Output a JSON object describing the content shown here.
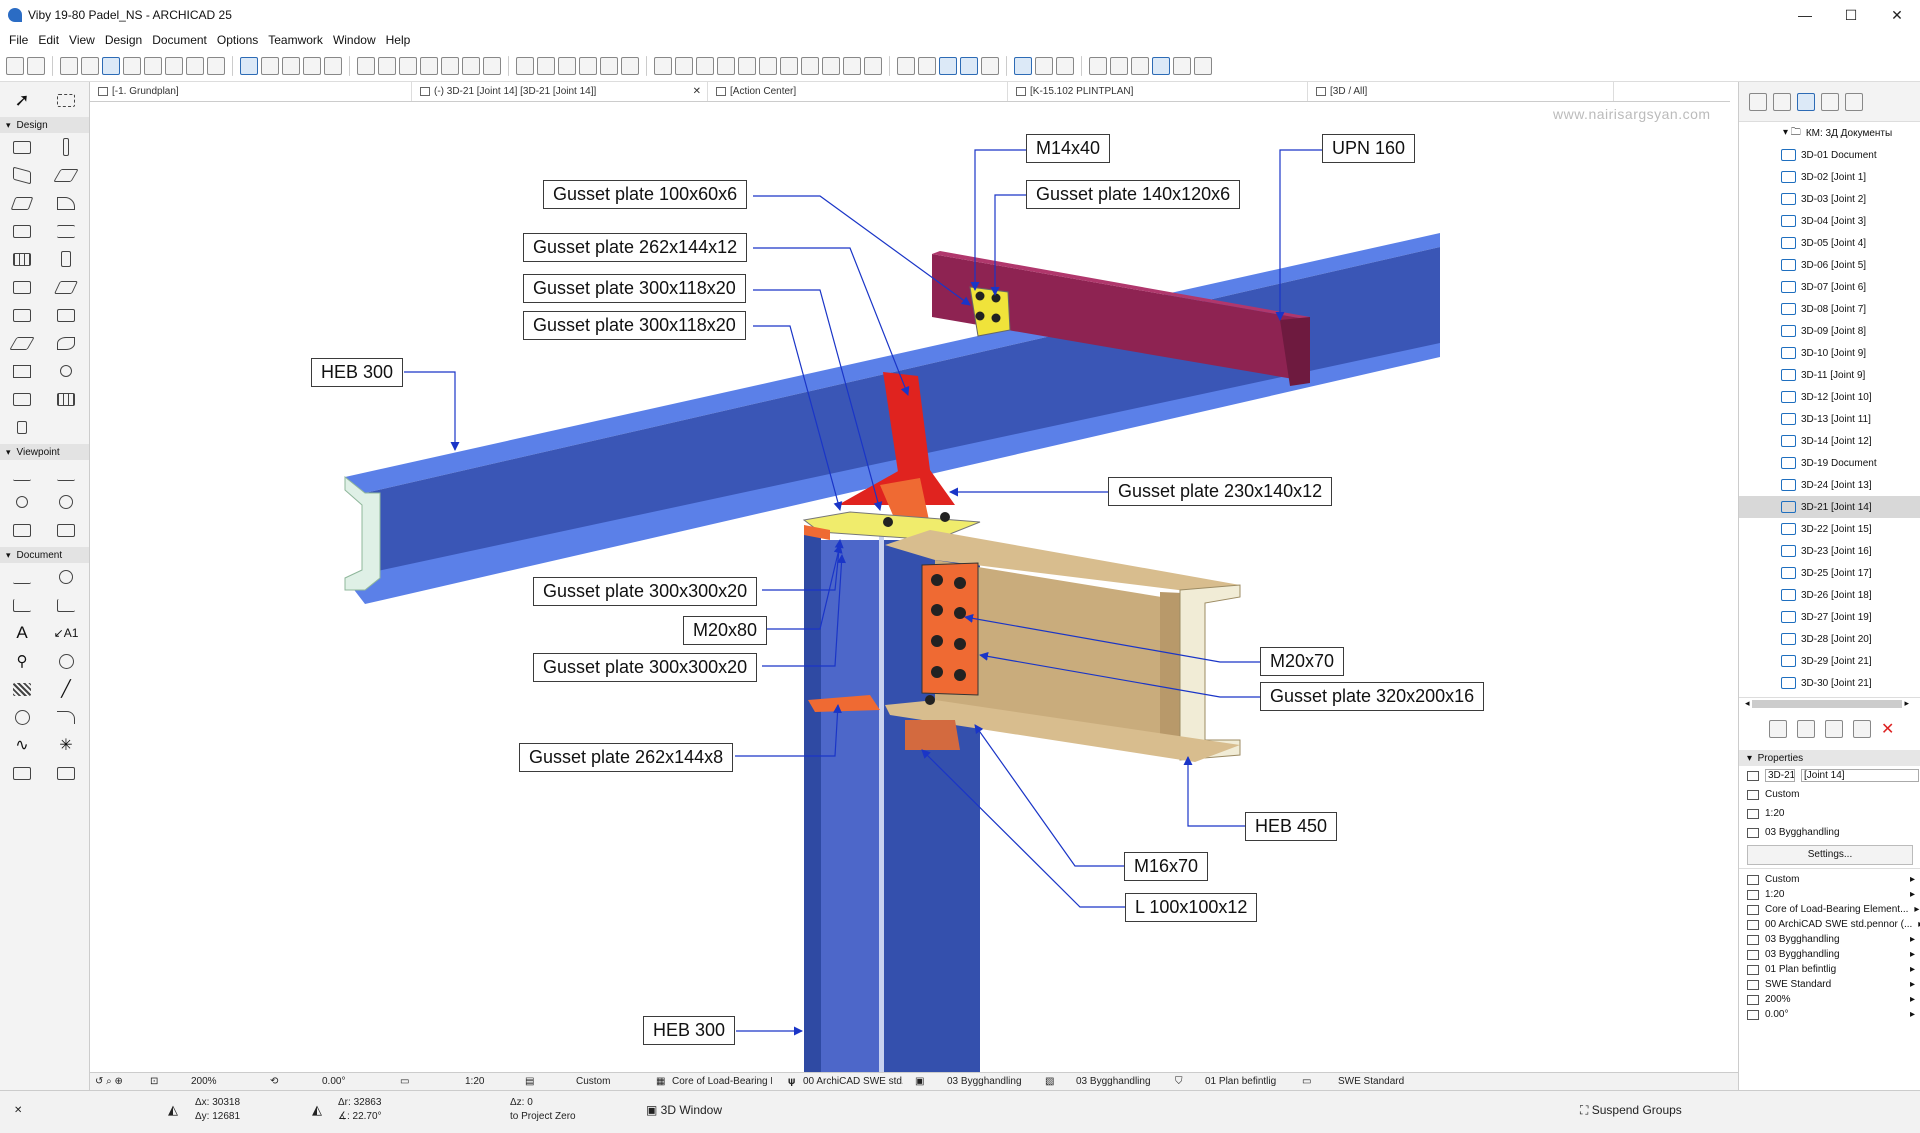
{
  "window": {
    "title": "Viby 19-80 Padel_NS - ARCHICAD 25",
    "minimize": "—",
    "maximize": "☐",
    "close": "✕"
  },
  "menu": [
    "File",
    "Edit",
    "View",
    "Design",
    "Document",
    "Options",
    "Teamwork",
    "Window",
    "Help"
  ],
  "tabs": [
    {
      "label": "[-1. Grundplan]"
    },
    {
      "label": "(-) 3D-21 [Joint 14] [3D-21 [Joint 14]]",
      "active": true,
      "close": "✕"
    },
    {
      "label": "[Action Center]"
    },
    {
      "label": "[K-15.102 PLINTPLAN]"
    },
    {
      "label": "[3D / All]"
    }
  ],
  "palette": {
    "sections": [
      "Design",
      "Viewpoint",
      "Document"
    ]
  },
  "watermark": "www.nairisargsyan.com",
  "callouts": {
    "m14x40": "M14x40",
    "upn160": "UPN 160",
    "gp100x60x6": "Gusset plate 100x60x6",
    "gp140x120x6": "Gusset plate 140x120x6",
    "gp262x144x12": "Gusset plate 262x144x12",
    "gp300x118x20_a": "Gusset plate 300x118x20",
    "gp300x118x20_b": "Gusset plate 300x118x20",
    "heb300_top": "HEB 300",
    "gp230x140x12": "Gusset plate 230x140x12",
    "gp300x300x20_a": "Gusset plate 300x300x20",
    "m20x80": "M20x80",
    "gp300x300x20_b": "Gusset plate 300x300x20",
    "m20x70": "M20x70",
    "gp320x200x16": "Gusset plate 320x200x16",
    "gp262x144x8": "Gusset plate 262x144x8",
    "heb450": "HEB 450",
    "m16x70": "M16x70",
    "l100": "L 100x100x12",
    "heb300_bottom": "HEB 300"
  },
  "navigator": {
    "root": "КМ: 3Д Документы",
    "items": [
      "3D-01 Document",
      "3D-02 [Joint 1]",
      "3D-03 [Joint 2]",
      "3D-04 [Joint 3]",
      "3D-05 [Joint 4]",
      "3D-06 [Joint 5]",
      "3D-07 [Joint 6]",
      "3D-08 [Joint 7]",
      "3D-09 [Joint 8]",
      "3D-10 [Joint 9]",
      "3D-11 [Joint 9]",
      "3D-12 [Joint 10]",
      "3D-13 [Joint 11]",
      "3D-14 [Joint 12]",
      "3D-19 Document",
      "3D-24 [Joint 13]",
      "3D-21 [Joint 14]",
      "3D-22 [Joint 15]",
      "3D-23 [Joint 16]",
      "3D-25 [Joint 17]",
      "3D-26 [Joint 18]",
      "3D-27 [Joint 19]",
      "3D-28 [Joint 20]",
      "3D-29 [Joint 21]",
      "3D-30 [Joint 21]"
    ],
    "selected_index": 16
  },
  "properties": {
    "header": "Properties",
    "id": "3D-21",
    "name": "[Joint 14]",
    "rows1": [
      "Custom",
      "1:20",
      "03 Bygghandling"
    ],
    "settings": "Settings...",
    "rows2": [
      "Custom",
      "1:20",
      "Core of Load-Bearing Element...",
      "00 ArchiCAD SWE std.pennor (...",
      "03 Bygghandling",
      "03 Bygghandling",
      "01 Plan befintlig",
      "SWE Standard",
      "200%",
      "0.00°"
    ]
  },
  "status_top": {
    "zoom": "200%",
    "angle": "0.00°",
    "scale": "1:20",
    "custom": "Custom",
    "layer": "Core of Load-Bearing E...",
    "pen": "00 ArchiCAD SWE std.p...",
    "dims": "03 Bygghandling",
    "mvo": "03 Bygghandling",
    "renovation": "01 Plan befintlig",
    "standard": "SWE Standard"
  },
  "status_bottom": {
    "dx": "Δx: 30318",
    "dy": "Δy: 12681",
    "dr": "Δr: 32863",
    "da": "∡: 22.70°",
    "dz": "Δz: 0",
    "zero": "to Project Zero",
    "window3d": "3D Window",
    "suspend": "Suspend Groups"
  },
  "colors": {
    "beam_blue": "#4f6fd8",
    "upn": "#8e2352",
    "plate_red": "#e0231f",
    "plate_orange": "#ef6a33",
    "plate_yellow": "#f0ec6c",
    "heb450": "#c9ac7c",
    "column": "#3550a8"
  }
}
